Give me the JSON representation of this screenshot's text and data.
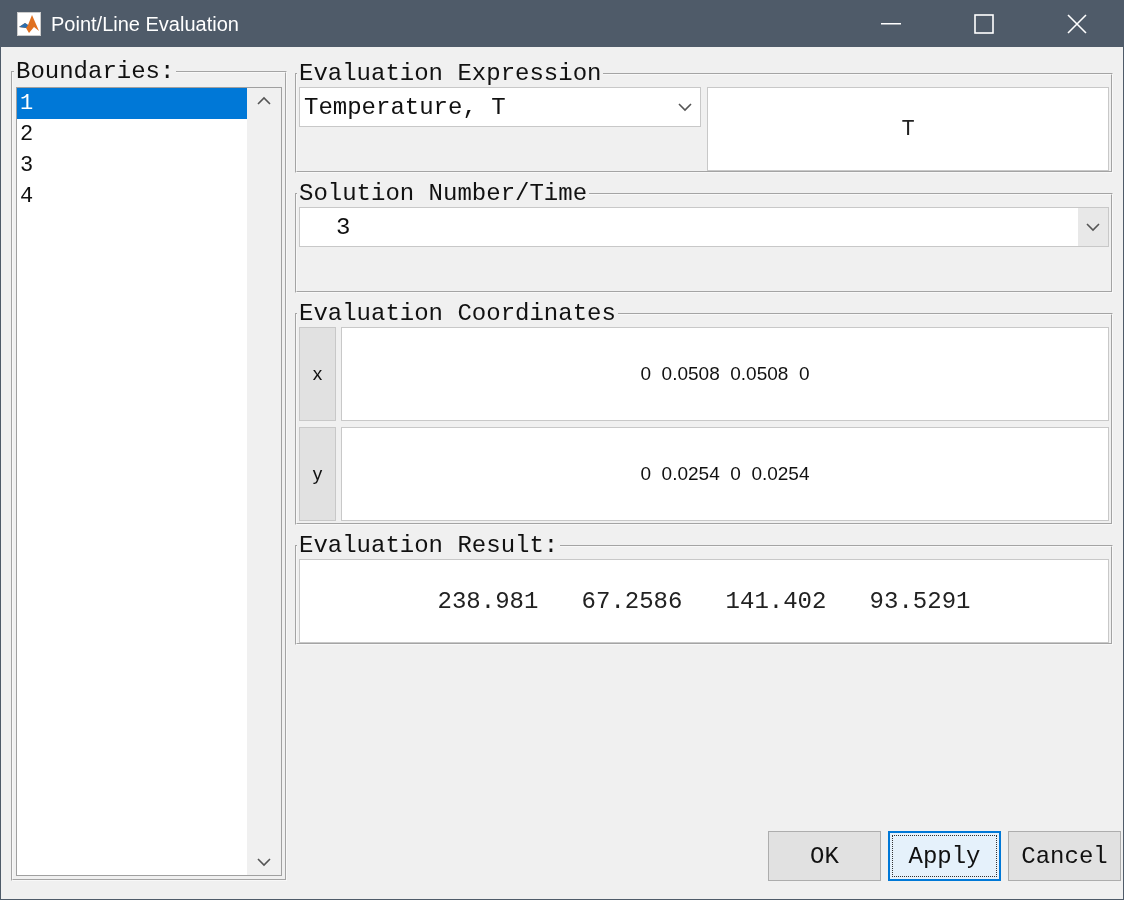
{
  "window": {
    "title": "Point/Line Evaluation"
  },
  "boundaries": {
    "label": "Boundaries:",
    "items": [
      {
        "label": "1",
        "selected": true
      },
      {
        "label": "2",
        "selected": false
      },
      {
        "label": "3",
        "selected": false
      },
      {
        "label": "4",
        "selected": false
      }
    ]
  },
  "expression": {
    "label": "Evaluation Expression",
    "value": "Temperature, T",
    "expression": "T"
  },
  "solution": {
    "label": "Solution Number/Time",
    "value": "3"
  },
  "coordinates": {
    "label": "Evaluation Coordinates",
    "rows": [
      {
        "axis": "x",
        "value": "0  0.0508  0.0508  0"
      },
      {
        "axis": "y",
        "value": "0  0.0254  0  0.0254"
      }
    ]
  },
  "result": {
    "label": "Evaluation Result:",
    "value": "238.981   67.2586   141.402   93.5291"
  },
  "buttons": [
    {
      "label": "OK",
      "focused": false
    },
    {
      "label": "Apply",
      "focused": true
    },
    {
      "label": "Cancel",
      "focused": false
    }
  ]
}
